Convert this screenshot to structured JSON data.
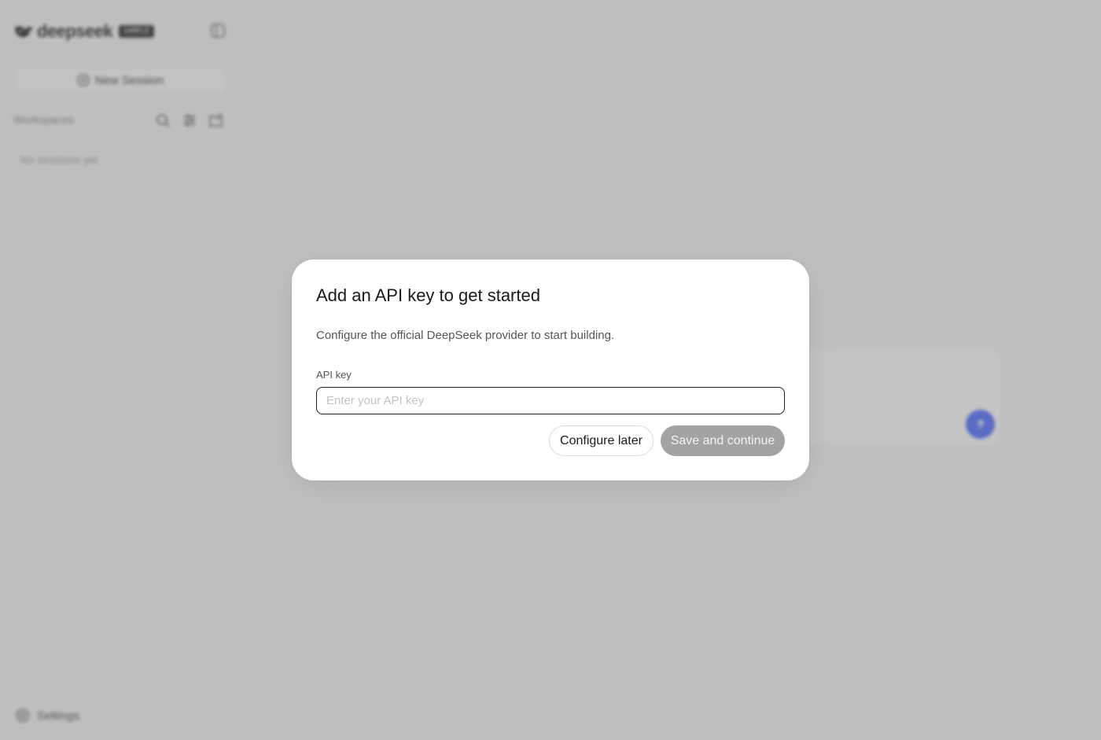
{
  "sidebar": {
    "brand_name": "deepseek",
    "brand_badge": "SAMPLE",
    "new_session_label": "New Session",
    "workspaces_label": "Workspaces",
    "empty_text": "No sessions yet",
    "settings_label": "Settings"
  },
  "modal": {
    "title": "Add an API key to get started",
    "description": "Configure the official DeepSeek provider to start building.",
    "field_label": "API key",
    "input_value": "",
    "input_placeholder": "Enter your API key",
    "configure_later_label": "Configure later",
    "save_label": "Save and continue"
  },
  "colors": {
    "accent": "#4d6bfe",
    "save_disabled": "#a3a3a3"
  }
}
